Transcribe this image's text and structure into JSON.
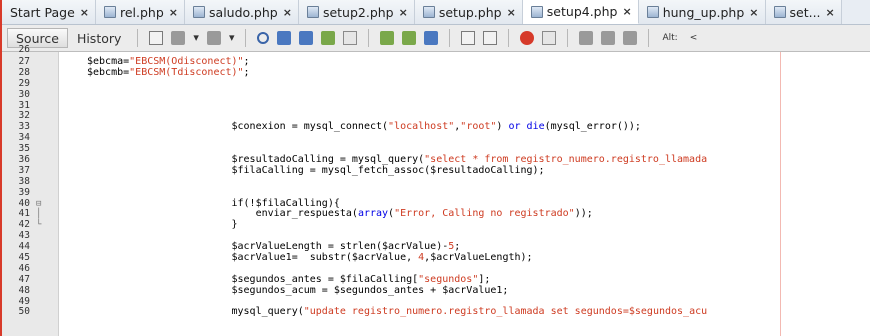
{
  "tabs": [
    {
      "label": "Start Page",
      "icon": "",
      "active": false
    },
    {
      "label": "rel.php",
      "icon": "php-file-icon",
      "active": false
    },
    {
      "label": "saludo.php",
      "icon": "php-file-icon",
      "active": false
    },
    {
      "label": "setup2.php",
      "icon": "php-file-icon",
      "active": false
    },
    {
      "label": "setup.php",
      "icon": "php-file-icon",
      "active": false
    },
    {
      "label": "setup4.php",
      "icon": "php-file-icon",
      "active": true
    },
    {
      "label": "hung_up.php",
      "icon": "php-file-icon",
      "active": false
    },
    {
      "label": "set...",
      "icon": "php-file-icon",
      "active": false
    }
  ],
  "toolbar": {
    "source_label": "Source",
    "history_label": "History",
    "alt_label": "Alt:",
    "less_label": "<"
  },
  "editor": {
    "lines": [
      {
        "n": "26",
        "fold": "",
        "code": ""
      },
      {
        "n": "27",
        "fold": "",
        "code": "$ebcma=\"EBCSM(Odisconect)\";"
      },
      {
        "n": "28",
        "fold": "",
        "code": "$ebcmb=\"EBCSM(Tdisconect)\";"
      },
      {
        "n": "29",
        "fold": "",
        "code": ""
      },
      {
        "n": "30",
        "fold": "",
        "code": ""
      },
      {
        "n": "31",
        "fold": "",
        "code": ""
      },
      {
        "n": "32",
        "fold": "",
        "code": ""
      },
      {
        "n": "33",
        "fold": "",
        "code": "                        $conexion = mysql_connect(\"localhost\",\"root\") or die(mysql_error());"
      },
      {
        "n": "34",
        "fold": "",
        "code": ""
      },
      {
        "n": "35",
        "fold": "",
        "code": ""
      },
      {
        "n": "36",
        "fold": "",
        "code": "                        $resultadoCalling = mysql_query(\"select * from registro_numero.registro_llamada"
      },
      {
        "n": "37",
        "fold": "",
        "code": "                        $filaCalling = mysql_fetch_assoc($resultadoCalling);"
      },
      {
        "n": "38",
        "fold": "",
        "code": ""
      },
      {
        "n": "39",
        "fold": "",
        "code": ""
      },
      {
        "n": "40",
        "fold": "⊟",
        "code": "                        if(!$filaCalling){"
      },
      {
        "n": "41",
        "fold": "│",
        "code": "                            enviar_respuesta(array(\"Error, Calling no registrado\"));"
      },
      {
        "n": "42",
        "fold": "└",
        "code": "                        }"
      },
      {
        "n": "43",
        "fold": "",
        "code": ""
      },
      {
        "n": "44",
        "fold": "",
        "code": "                        $acrValueLength = strlen($acrValue)-5;"
      },
      {
        "n": "45",
        "fold": "",
        "code": "                        $acrValue1=  substr($acrValue, 4,$acrValueLength);"
      },
      {
        "n": "46",
        "fold": "",
        "code": ""
      },
      {
        "n": "47",
        "fold": "",
        "code": "                        $segundos_antes = $filaCalling[\"segundos\"];"
      },
      {
        "n": "48",
        "fold": "",
        "code": "                        $segundos_acum = $segundos_antes + $acrValue1;"
      },
      {
        "n": "49",
        "fold": "",
        "code": ""
      },
      {
        "n": "50",
        "fold": "",
        "code": "                        mysql_query(\"update registro_numero.registro_llamada set segundos=$segundos_acu"
      }
    ]
  },
  "colors": {
    "string": "#ce3b21",
    "keyword": "#0000e6",
    "gutter": "#e9e9e9",
    "right_margin": "#f3b9b2",
    "window_border": "#d83a2a"
  }
}
